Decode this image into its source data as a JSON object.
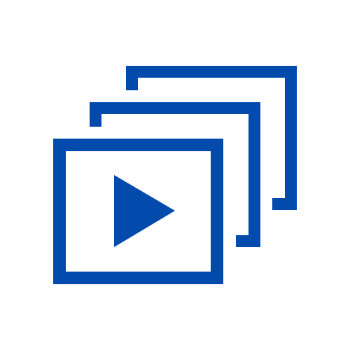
{
  "icon": {
    "name": "video-playlist-icon",
    "color": "#034AAD",
    "background": "#FFFFFF",
    "layers": [
      "back-frame",
      "middle-frame",
      "front-frame",
      "play-triangle"
    ]
  }
}
